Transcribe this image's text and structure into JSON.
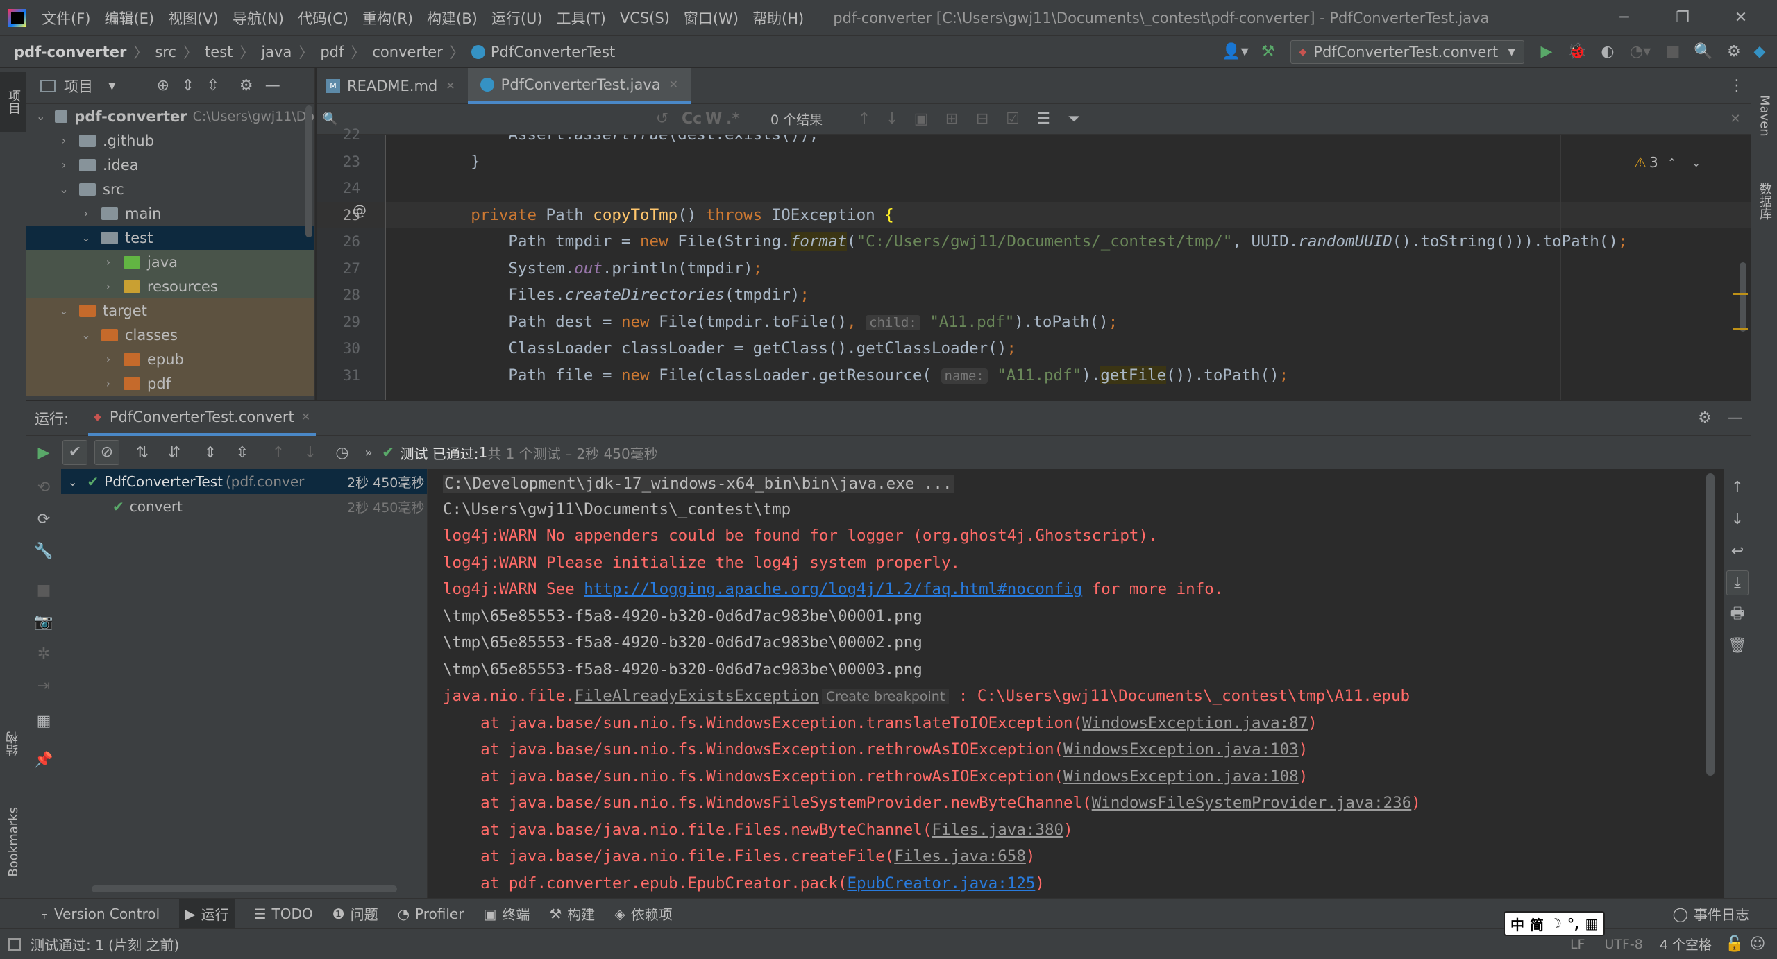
{
  "titlebar": {
    "app_icon": "intellij-logo-icon",
    "menu": [
      "文件(F)",
      "编辑(E)",
      "视图(V)",
      "导航(N)",
      "代码(C)",
      "重构(R)",
      "构建(B)",
      "运行(U)",
      "工具(T)",
      "VCS(S)",
      "窗口(W)",
      "帮助(H)"
    ],
    "window_title": "pdf-converter [C:\\Users\\gwj11\\Documents\\_contest\\pdf-converter] - PdfConverterTest.java"
  },
  "navbar": {
    "breadcrumb": [
      "pdf-converter",
      "src",
      "test",
      "java",
      "pdf",
      "converter",
      "PdfConverterTest"
    ],
    "run_config": "PdfConverterTest.convert"
  },
  "left_strip": {
    "project_label": "项目",
    "structure_label": "结构",
    "bookmarks_label": "Bookmarks"
  },
  "right_strip": {
    "maven_label": "Maven",
    "database_label": "数据库"
  },
  "project": {
    "header": "项目",
    "tree": [
      {
        "label": "pdf-converter",
        "extra": "C:\\Users\\gwj11\\Do",
        "depth": 0,
        "expanded": true,
        "kind": "module"
      },
      {
        "label": ".github",
        "depth": 1,
        "expanded": false,
        "kind": "folder"
      },
      {
        "label": ".idea",
        "depth": 1,
        "expanded": false,
        "kind": "folder"
      },
      {
        "label": "src",
        "depth": 1,
        "expanded": true,
        "kind": "folder"
      },
      {
        "label": "main",
        "depth": 2,
        "expanded": false,
        "kind": "folder"
      },
      {
        "label": "test",
        "depth": 2,
        "expanded": true,
        "kind": "folder",
        "state": "selected"
      },
      {
        "label": "java",
        "depth": 3,
        "expanded": false,
        "kind": "test-src",
        "state": "test"
      },
      {
        "label": "resources",
        "depth": 3,
        "expanded": false,
        "kind": "test-res",
        "state": "test"
      },
      {
        "label": "target",
        "depth": 1,
        "expanded": true,
        "kind": "excluded",
        "state": "target"
      },
      {
        "label": "classes",
        "depth": 2,
        "expanded": true,
        "kind": "excluded",
        "state": "target"
      },
      {
        "label": "epub",
        "depth": 3,
        "expanded": false,
        "kind": "excluded",
        "state": "target"
      },
      {
        "label": "pdf",
        "depth": 3,
        "expanded": false,
        "kind": "excluded",
        "state": "target"
      }
    ]
  },
  "editor": {
    "tabs": [
      {
        "label": "README.md",
        "active": false,
        "icon": "markdown-icon"
      },
      {
        "label": "PdfConverterTest.java",
        "active": true,
        "icon": "java-class-icon"
      }
    ],
    "find": {
      "results": "0 个结果",
      "match_case": "Cc",
      "words": "W",
      "regex": ".*"
    },
    "warnings": "3",
    "line_numbers": [
      "22",
      "23",
      "24",
      "25",
      "26",
      "27",
      "28",
      "29",
      "30",
      "31"
    ],
    "hint_child": "child:",
    "hint_name": "name:"
  },
  "run": {
    "label": "运行:",
    "tab": "PdfConverterTest.convert",
    "status_prefix": "测试 已通过:",
    "status_count": "1",
    "status_suffix": "共 1 个测试 – 2秒 450毫秒",
    "test_root": "PdfConverterTest",
    "test_root_pkg": "(pdf.conver",
    "test_root_time": "2秒 450毫秒",
    "test_child": "convert",
    "test_child_time": "2秒 450毫秒",
    "console": {
      "l1": "C:\\Development\\jdk-17_windows-x64_bin\\bin\\java.exe ...",
      "l2": "C:\\Users\\gwj11\\Documents\\_contest\\tmp",
      "l3": "log4j:WARN No appenders could be found for logger (org.ghost4j.Ghostscript).",
      "l4": "log4j:WARN Please initialize the log4j system properly.",
      "l5a": "log4j:WARN See ",
      "l5b": "http://logging.apache.org/log4j/1.2/faq.html#noconfig",
      "l5c": " for more info.",
      "l6": "\\tmp\\65e85553-f5a8-4920-b320-0d6d7ac983be\\00001.png",
      "l7": "\\tmp\\65e85553-f5a8-4920-b320-0d6d7ac983be\\00002.png",
      "l8": "\\tmp\\65e85553-f5a8-4920-b320-0d6d7ac983be\\00003.png",
      "l9a": "java.nio.file.",
      "l9b": "FileAlreadyExistsException",
      "l9c": "Create breakpoint",
      "l9d": " : C:\\Users\\gwj11\\Documents\\_contest\\tmp\\A11.epub",
      "st1a": "    at java.base/sun.nio.fs.WindowsException.translateToIOException(",
      "st1b": "WindowsException.java:87",
      "st1c": ")",
      "st2a": "    at java.base/sun.nio.fs.WindowsException.rethrowAsIOException(",
      "st2b": "WindowsException.java:103",
      "st2c": ")",
      "st3a": "    at java.base/sun.nio.fs.WindowsException.rethrowAsIOException(",
      "st3b": "WindowsException.java:108",
      "st3c": ")",
      "st4a": "    at java.base/sun.nio.fs.WindowsFileSystemProvider.newByteChannel(",
      "st4b": "WindowsFileSystemProvider.java:236",
      "st4c": ")",
      "st5a": "    at java.base/java.nio.file.Files.newByteChannel(",
      "st5b": "Files.java:380",
      "st5c": ")",
      "st6a": "    at java.base/java.nio.file.Files.createFile(",
      "st6b": "Files.java:658",
      "st6c": ")",
      "st7a": "    at pdf.converter.epub.EpubCreator.pack(",
      "st7b": "EpubCreator.java:125",
      "st7c": ")"
    }
  },
  "bottom_tabs": [
    "Version Control",
    "运行",
    "TODO",
    "问题",
    "Profiler",
    "终端",
    "构建",
    "依赖项"
  ],
  "event_log": "事件日志",
  "status": {
    "message": "测试通过: 1 (片刻 之前)",
    "line_sep": "LF",
    "encoding": "UTF-8",
    "indent": "4 个空格",
    "ime": [
      "中",
      "简"
    ]
  }
}
